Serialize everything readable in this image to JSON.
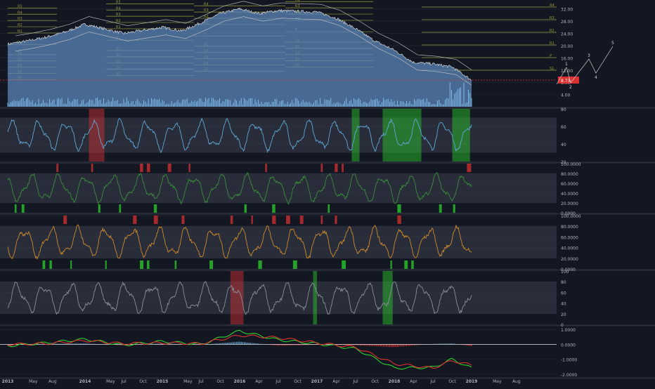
{
  "chart_data": [
    {
      "type": "area",
      "pane": "price",
      "ylim": [
        0,
        34
      ],
      "yticks": [
        4,
        8,
        12,
        16,
        20,
        24,
        28,
        32
      ],
      "ytick_labels": [
        "4.00",
        "8.00",
        "12.00",
        "16.00",
        "20.00",
        "24.00",
        "28.00",
        "32.00"
      ],
      "last_price_label": "8.73",
      "last_price": 8.73,
      "x": [
        2013.0,
        2013.25,
        2013.5,
        2013.75,
        2014.0,
        2014.25,
        2014.5,
        2014.75,
        2015.0,
        2015.25,
        2015.5,
        2015.75,
        2016.0,
        2016.25,
        2016.5,
        2016.75,
        2017.0,
        2017.25,
        2017.5,
        2017.75,
        2018.0,
        2018.25,
        2018.5,
        2018.75,
        2019.0
      ],
      "series": [
        {
          "values": [
            20.5,
            21.5,
            22.8,
            24.5,
            27.0,
            25.5,
            24.0,
            25.0,
            26.0,
            24.8,
            27.5,
            30.5,
            32.0,
            30.5,
            31.5,
            31.2,
            31.0,
            29.0,
            25.5,
            21.5,
            18.5,
            14.5,
            14.0,
            13.0,
            8.7
          ]
        }
      ],
      "levels_left": [
        "R5",
        "R4",
        "R3",
        "R2",
        "R1",
        "P",
        "S1",
        "S2",
        "S3",
        "S4",
        "S5"
      ],
      "levels_right": [
        "R4",
        "R3",
        "R2",
        "R1",
        "P",
        "S1"
      ],
      "wave_labels": [
        "1",
        "2",
        "3",
        "4",
        "5"
      ]
    },
    {
      "type": "line",
      "pane": "oscillator-1",
      "ylim": [
        20,
        80
      ],
      "yticks": [
        20,
        40,
        60,
        80
      ],
      "ytick_labels": [
        "20",
        "40",
        "60",
        "80"
      ],
      "band": [
        30,
        70
      ]
    },
    {
      "type": "line",
      "pane": "oscillator-2",
      "ylim": [
        0,
        100
      ],
      "yticks": [
        0,
        20,
        40,
        60,
        80,
        100
      ],
      "ytick_labels": [
        "0.0000",
        "20.0000",
        "40.0000",
        "60.0000",
        "80.0000",
        "100.0000"
      ],
      "band": [
        20,
        80
      ]
    },
    {
      "type": "line",
      "pane": "oscillator-3",
      "ylim": [
        0,
        100
      ],
      "yticks": [
        0,
        20,
        40,
        60,
        80,
        100
      ],
      "ytick_labels": [
        "0.0000",
        "20.0000",
        "40.0000",
        "60.0000",
        "80.0000",
        "100.0000"
      ],
      "band": [
        20,
        80
      ]
    },
    {
      "type": "line",
      "pane": "oscillator-4",
      "ylim": [
        0,
        100
      ],
      "yticks": [
        0,
        20,
        40,
        60,
        80,
        100
      ],
      "ytick_labels": [
        "0",
        "20",
        "40",
        "60",
        "80",
        "100"
      ],
      "band": [
        20,
        80
      ]
    },
    {
      "type": "line",
      "pane": "macd",
      "ylim": [
        -2.2,
        1.2
      ],
      "yticks": [
        1.0,
        0.0,
        -1.0,
        -2.0
      ],
      "ytick_labels": [
        "1.0000",
        "0.0000",
        "-1.0000",
        "-2.0000"
      ],
      "x": [
        2013.0,
        2013.5,
        2014.0,
        2014.5,
        2015.0,
        2015.5,
        2016.0,
        2016.5,
        2017.0,
        2017.5,
        2018.0,
        2018.5,
        2018.75,
        2019.0
      ],
      "series": [
        {
          "values": [
            -0.1,
            0.1,
            0.35,
            -0.05,
            0.2,
            0.0,
            0.9,
            0.3,
            0.05,
            -0.3,
            -1.6,
            -1.55,
            -1.0,
            -1.6
          ]
        },
        {
          "values": [
            0.0,
            0.05,
            0.25,
            0.05,
            0.1,
            0.05,
            0.6,
            0.45,
            0.1,
            -0.2,
            -1.3,
            -1.6,
            -1.1,
            -1.4
          ]
        }
      ]
    }
  ],
  "x_axis": {
    "labels": [
      "2013",
      "May",
      "Aug",
      "2014",
      "May",
      "Jul",
      "Oct",
      "2015",
      "May",
      "Jul",
      "Oct",
      "2016",
      "Apr",
      "Jul",
      "Oct",
      "2017",
      "Apr",
      "Jul",
      "Oct",
      "2018",
      "Apr",
      "Jul",
      "Oct",
      "2019",
      "May",
      "Aug"
    ],
    "values": [
      2013.0,
      2013.33,
      2013.58,
      2014.0,
      2014.33,
      2014.5,
      2014.75,
      2015.0,
      2015.33,
      2015.5,
      2015.75,
      2016.0,
      2016.25,
      2016.5,
      2016.75,
      2017.0,
      2017.25,
      2017.5,
      2017.75,
      2018.0,
      2018.25,
      2018.5,
      2018.75,
      2019.0,
      2019.33,
      2019.58
    ],
    "range": [
      2012.9,
      2020.1
    ]
  },
  "colors": {
    "background": "#131722",
    "price_fill": "#5b85b8",
    "up_signal": "#2bd12b",
    "down_signal": "#d93030",
    "osc_line": "#5fa8d8",
    "pivot_line": "#9a9a3a",
    "macd_line": "#2bd12b",
    "signal_line": "#e03030",
    "axis_text": "#b2b5be"
  }
}
